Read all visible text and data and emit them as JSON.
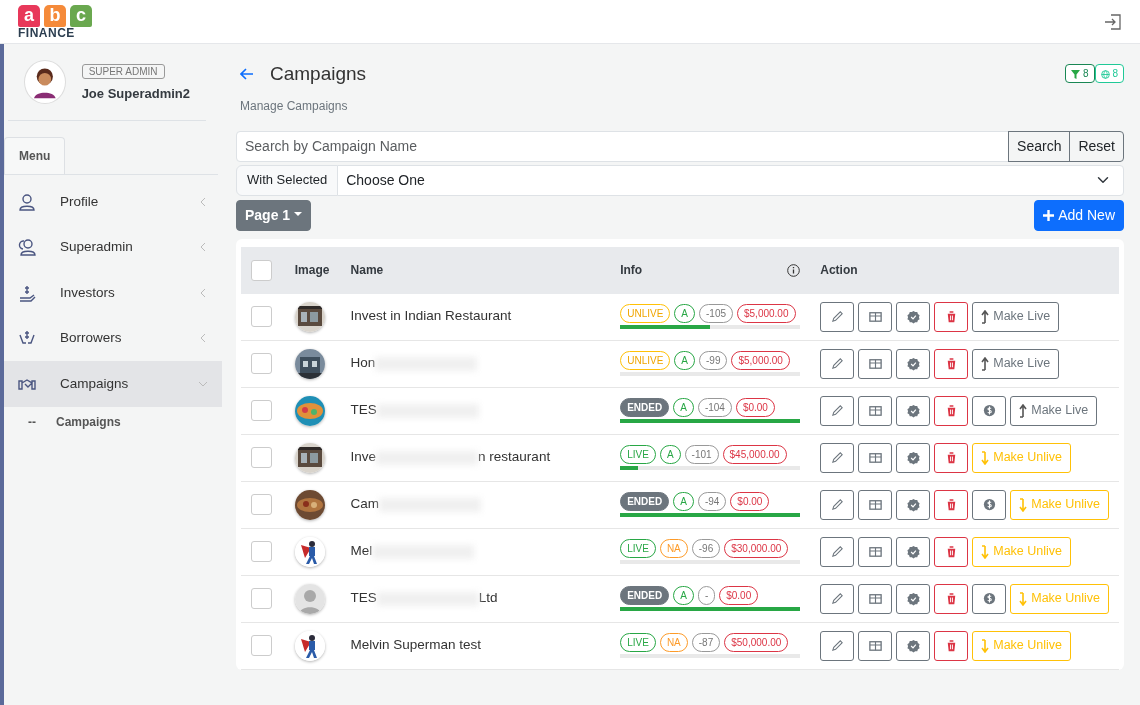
{
  "logo": {
    "letters": [
      "a",
      "b",
      "c"
    ],
    "word": "FINANCE"
  },
  "user": {
    "role": "SUPER ADMIN",
    "name": "Joe Superadmin2"
  },
  "menu_tab": "Menu",
  "sidebar": {
    "items": [
      {
        "label": "Profile",
        "expanded": false,
        "selected": false
      },
      {
        "label": "Superadmin",
        "expanded": false,
        "selected": false
      },
      {
        "label": "Investors",
        "expanded": false,
        "selected": false
      },
      {
        "label": "Borrowers",
        "expanded": false,
        "selected": false
      },
      {
        "label": "Campaigns",
        "expanded": true,
        "selected": true,
        "children": [
          {
            "marker": "--",
            "label": "Campaigns"
          }
        ]
      }
    ]
  },
  "page": {
    "title": "Campaigns",
    "subtitle": "Manage Campaigns",
    "filter_count": "8",
    "globe_count": "8"
  },
  "search": {
    "placeholder": "Search by Campaign Name",
    "buttons": [
      "Search",
      "Reset"
    ]
  },
  "bulk": {
    "label": "With Selected",
    "value": "Choose One"
  },
  "pager": "Page 1",
  "add_button": "Add New",
  "table": {
    "all_checked": false,
    "columns": [
      "Image",
      "Name",
      "Info",
      "Action"
    ],
    "rows": [
      {
        "checked": false,
        "name": "Invest in Indian Restaurant",
        "blurred": false,
        "status": {
          "kind": "unlive",
          "text": "UNLIVE"
        },
        "grade": {
          "kind": "good",
          "text": "A"
        },
        "count": "-105",
        "amount": "$5,000.00",
        "level": 0.5,
        "payout": false,
        "toggle": {
          "kind": "live",
          "text": "Make Live"
        }
      },
      {
        "checked": false,
        "name": "Hon",
        "blurred": true,
        "status": {
          "kind": "unlive",
          "text": "UNLIVE"
        },
        "grade": {
          "kind": "good",
          "text": "A"
        },
        "count": "-99",
        "amount": "$5,000.00",
        "level": 0,
        "payout": false,
        "toggle": {
          "kind": "live",
          "text": "Make Live"
        }
      },
      {
        "checked": false,
        "name": "TES",
        "blurred": true,
        "status": {
          "kind": "ended",
          "text": "ENDED"
        },
        "grade": {
          "kind": "good",
          "text": "A"
        },
        "count": "-104",
        "amount": "$0.00",
        "level": 1,
        "payout": true,
        "toggle": {
          "kind": "live",
          "text": "Make Live"
        }
      },
      {
        "checked": false,
        "name": "Inve",
        "blurred": true,
        "name_end": "n restaurant",
        "status": {
          "kind": "live",
          "text": "LIVE"
        },
        "grade": {
          "kind": "good",
          "text": "A"
        },
        "count": "-101",
        "amount": "$45,000.00",
        "level": 0.1,
        "payout": false,
        "toggle": {
          "kind": "unlive",
          "text": "Make Unlive"
        }
      },
      {
        "checked": false,
        "name": "Cam",
        "blurred": true,
        "status": {
          "kind": "ended",
          "text": "ENDED"
        },
        "grade": {
          "kind": "good",
          "text": "A"
        },
        "count": "-94",
        "amount": "$0.00",
        "level": 1,
        "payout": true,
        "toggle": {
          "kind": "unlive",
          "text": "Make Unlive"
        }
      },
      {
        "checked": false,
        "name": "Mel",
        "blurred": true,
        "status": {
          "kind": "live",
          "text": "LIVE"
        },
        "grade": {
          "kind": "warn",
          "text": "NA"
        },
        "count": "-96",
        "amount": "$30,000.00",
        "level": 0,
        "payout": false,
        "toggle": {
          "kind": "unlive",
          "text": "Make Unlive"
        }
      },
      {
        "checked": false,
        "name": "TES",
        "blurred": true,
        "name_end": "Ltd",
        "status": {
          "kind": "ended",
          "text": "ENDED"
        },
        "grade": {
          "kind": "good",
          "text": "A"
        },
        "count": "-",
        "amount": "$0.00",
        "level": 1,
        "payout": true,
        "toggle": {
          "kind": "unlive",
          "text": "Make Unlive"
        }
      },
      {
        "checked": false,
        "name": "Melvin Superman test",
        "blurred": false,
        "status": {
          "kind": "live",
          "text": "LIVE"
        },
        "grade": {
          "kind": "warn",
          "text": "NA"
        },
        "count": "-87",
        "amount": "$50,000.00",
        "level": 0,
        "payout": false,
        "toggle": {
          "kind": "unlive",
          "text": "Make Unlive"
        }
      }
    ]
  }
}
